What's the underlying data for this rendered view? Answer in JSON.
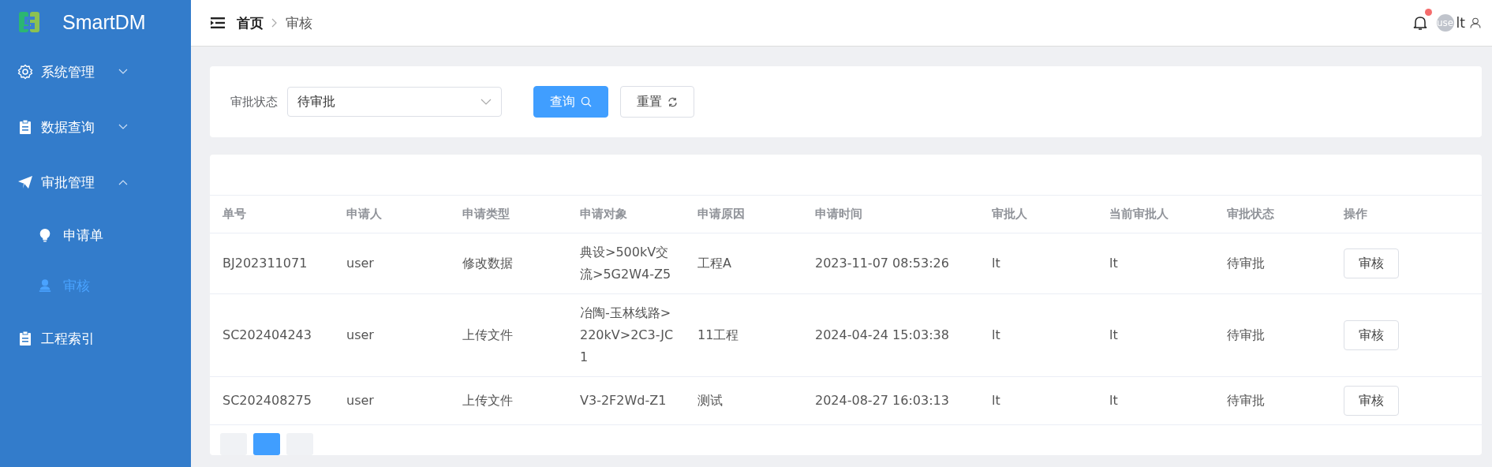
{
  "sidebar": {
    "logo": "SmartDM",
    "items": [
      {
        "label": "系统管理",
        "expanded": false
      },
      {
        "label": "数据查询",
        "expanded": false
      },
      {
        "label": "审批管理",
        "expanded": true,
        "children": [
          {
            "label": "申请单",
            "selected": false
          },
          {
            "label": "审核",
            "selected": true
          }
        ]
      },
      {
        "label": "工程索引"
      }
    ]
  },
  "header": {
    "breadcrumb": [
      "首页",
      "审核"
    ],
    "notification": true,
    "avatar": "use",
    "username": "lt"
  },
  "filter": {
    "label": "审批状态",
    "value": "待审批",
    "buttons": [
      {
        "label": "查询",
        "kind": "primary"
      },
      {
        "label": "重置",
        "kind": "reset"
      }
    ]
  },
  "table": {
    "columns": [
      "单号",
      "申请人",
      "申请类型",
      "申请对象",
      "申请原因",
      "申请时间",
      "审批人",
      "当前审批人",
      "审批状态",
      "操作"
    ],
    "rows": [
      {
        "cells": [
          "BJ202311071",
          "user",
          "修改数据",
          "典设>500kV交流>5G2W4-Z5",
          "工程A",
          "2023-11-07 08:53:26",
          "lt",
          "lt",
          "待审批"
        ],
        "action": "审核"
      },
      {
        "cells": [
          "SC202404243",
          "user",
          "上传文件",
          "冶陶-玉林线路>220kV>2C3-JC1",
          "11工程",
          "2024-04-24 15:03:38",
          "lt",
          "lt",
          "待审批"
        ],
        "action": "审核"
      },
      {
        "cells": [
          "SC202408275",
          "user",
          "上传文件",
          "V3-2F2Wd-Z1",
          "测试",
          "2024-08-27 16:03:13",
          "lt",
          "lt",
          "待审批"
        ],
        "action": "审核"
      }
    ]
  },
  "pagination": [
    {
      "selected": false
    },
    {
      "selected": true
    },
    {
      "selected": false
    }
  ]
}
